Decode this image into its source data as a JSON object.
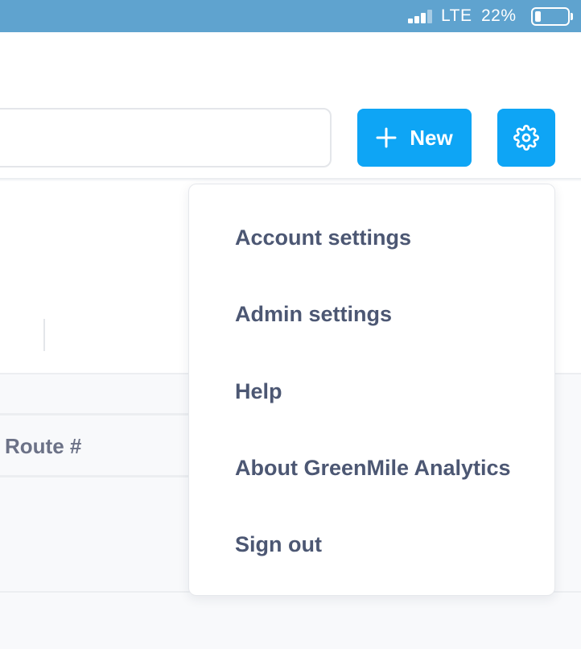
{
  "status_bar": {
    "carrier": "LTE",
    "battery_percent": "22%",
    "battery_level": 0.22,
    "signal_bars_active": 3,
    "signal_bars_total": 4
  },
  "header": {
    "new_button_label": "New"
  },
  "table": {
    "columns": [
      "Route #"
    ]
  },
  "menu": {
    "items": [
      "Account settings",
      "Admin settings",
      "Help",
      "About GreenMile Analytics",
      "Sign out"
    ]
  },
  "icons": {
    "add": "plus-icon",
    "settings": "gear-icon"
  },
  "colors": {
    "status_bar": "#5fa3cf",
    "accent": "#0ea5f5",
    "menu_text": "#4c5773",
    "muted_text": "#6c7287"
  }
}
